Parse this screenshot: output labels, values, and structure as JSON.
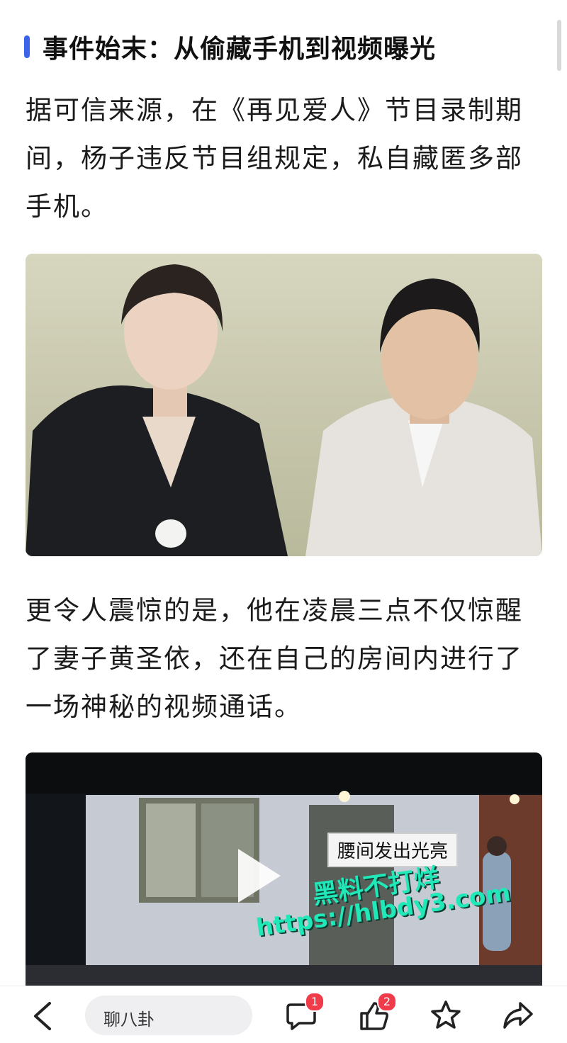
{
  "heading": "事件始末：从偷藏手机到视频曝光",
  "paragraphs": [
    "据可信来源，在《再见爱人》节目录制期间，杨子违反节目组规定，私自藏匿多部手机。",
    "更令人震惊的是，他在凌晨三点不仅惊醒了妻子黄圣依，还在自己的房间内进行了一场神秘的视频通话。"
  ],
  "video": {
    "caption": "腰间发出光亮",
    "watermark_line1": "黑料不打烊",
    "watermark_line2": "https://hlbdy3.com"
  },
  "bottom_bar": {
    "chat_placeholder": "聊八卦",
    "comment_count": "1",
    "like_count": "2"
  },
  "colors": {
    "accent": "#3b64e8",
    "badge": "#f03b4a",
    "watermark": "#21e8b8"
  }
}
